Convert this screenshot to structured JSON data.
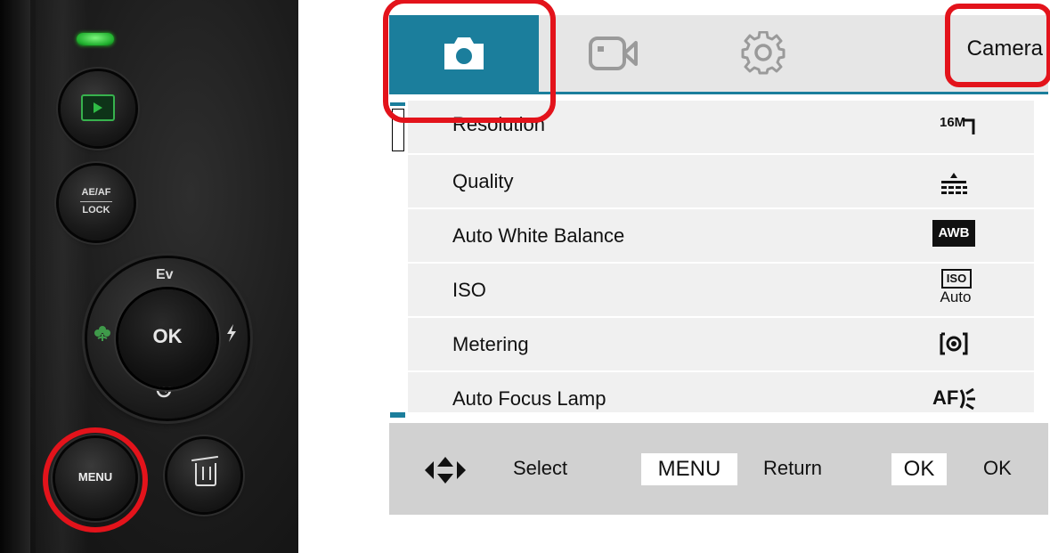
{
  "camera_body": {
    "aeaf_line1": "AE/AF",
    "aeaf_line2": "LOCK",
    "ev_label": "Ev",
    "ok_label": "OK",
    "menu_label": "MENU"
  },
  "screen": {
    "tabs": [
      {
        "icon": "camera-icon",
        "active": true
      },
      {
        "icon": "video-camera-icon",
        "active": false
      },
      {
        "icon": "gear-icon",
        "active": false
      }
    ],
    "tab_title": "Camera",
    "menu_items": [
      {
        "label": "Resolution",
        "value": "16M"
      },
      {
        "label": "Quality",
        "value_icon": "quality-fine-icon"
      },
      {
        "label": "Auto White Balance",
        "value": "AWB"
      },
      {
        "label": "ISO",
        "value_line1": "ISO",
        "value_line2": "Auto"
      },
      {
        "label": "Metering",
        "value_icon": "metering-center-icon"
      },
      {
        "label": "Auto Focus Lamp",
        "value": "AF"
      }
    ],
    "footer": {
      "select_label": "Select",
      "menu_key": "MENU",
      "return_label": "Return",
      "ok_key": "OK",
      "ok_label": "OK"
    }
  },
  "highlight_color": "#e3131b",
  "accent_color": "#1b7e9c"
}
